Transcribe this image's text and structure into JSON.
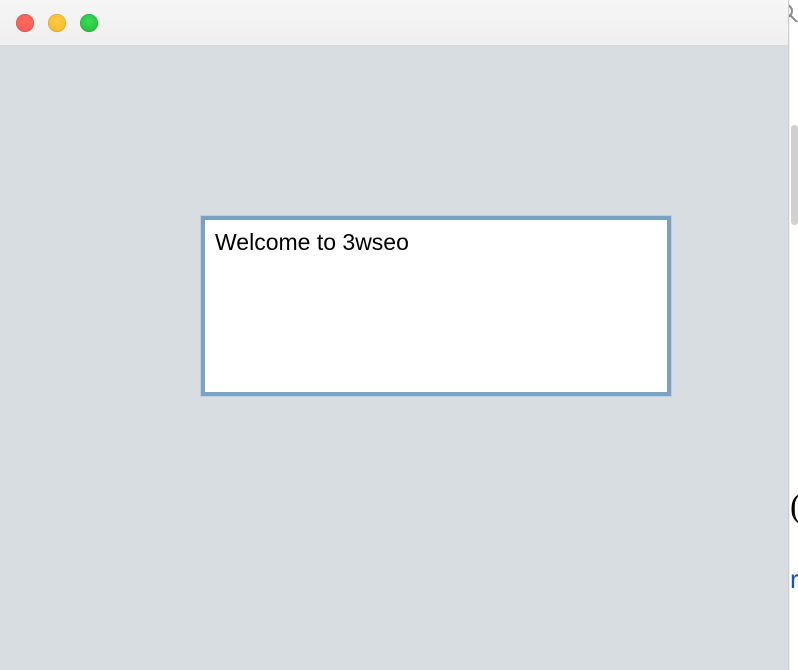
{
  "window": {
    "traffic_lights": {
      "close": "close",
      "minimize": "minimize",
      "zoom": "zoom"
    }
  },
  "text_widget": {
    "content": "Welcome to 3wseo"
  },
  "background_sliver": {
    "glyph_paren": "(",
    "glyph_link_fragment": "r"
  }
}
